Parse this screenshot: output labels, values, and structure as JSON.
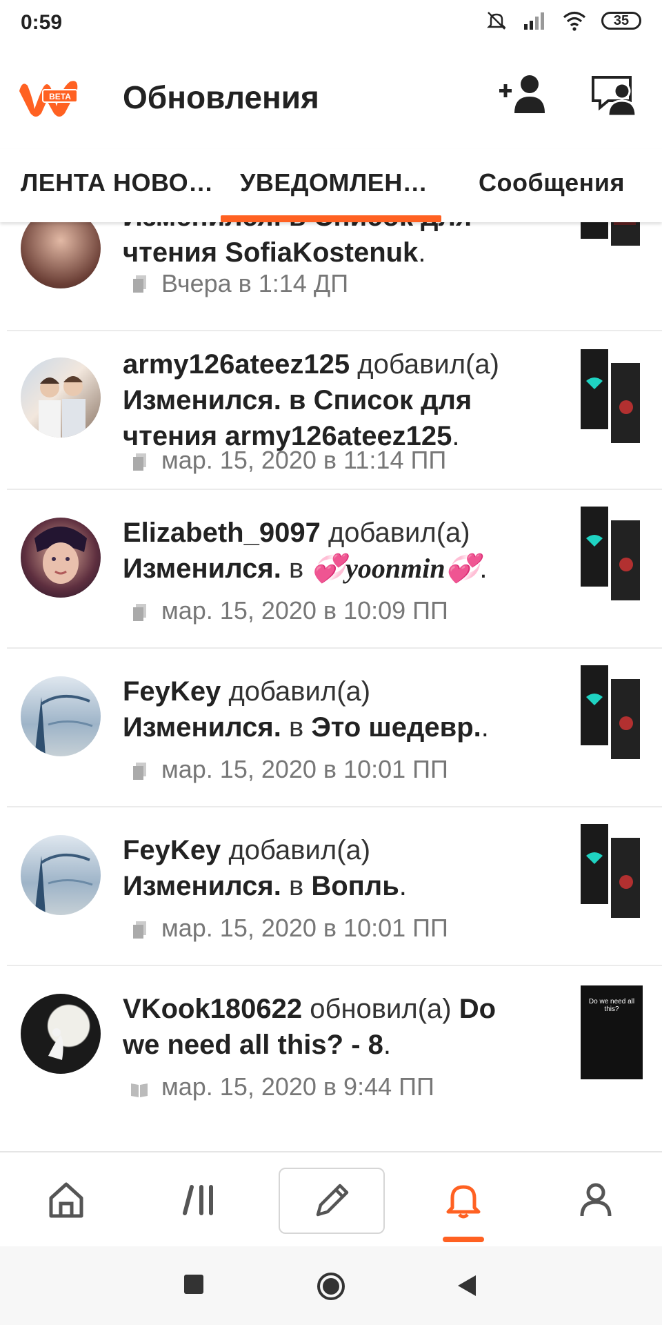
{
  "status_bar": {
    "time": "0:59",
    "battery": "35"
  },
  "app_bar": {
    "title": "Обновления",
    "logo_badge": "BETA"
  },
  "tabs": [
    {
      "label": "ЛЕНТА НОВО…"
    },
    {
      "label": "УВЕДОМЛЕН…"
    },
    {
      "label": "Сообщения"
    }
  ],
  "feed": [
    {
      "line_top": "Изменился. в Список для",
      "line2": "чтения SofiaKostenuk",
      "time": "Вчера в 1:14 ДП"
    },
    {
      "user": "army126ateez125",
      "verb": "добавил(а)",
      "line2": "Изменился. в Список для",
      "line3": "чтения army126ateez125",
      "time": "мар. 15, 2020 в 11:14 ПП"
    },
    {
      "user": "Elizabeth_9097",
      "verb": "добавил(а)",
      "story": "Изменился.",
      "in": "в",
      "list": "💞yoonmin💞",
      "time": "мар. 15, 2020 в 10:09 ПП"
    },
    {
      "user": "FeyKey",
      "verb": "добавил(а)",
      "story": "Изменился.",
      "in": "в",
      "list": "Это шедевр.",
      "time": "мар. 15, 2020 в 10:01 ПП"
    },
    {
      "user": "FeyKey",
      "verb": "добавил(а)",
      "story": "Изменился.",
      "in": "в",
      "list": "Вопль",
      "time": "мар. 15, 2020 в 10:01 ПП"
    },
    {
      "user": "VKook180622",
      "verb": "обновил(а)",
      "title_a": "Do",
      "title_b": "we need all this? - 8",
      "time": "мар. 15, 2020 в 9:44 ПП",
      "thumb_caption": "Do we need all this?"
    }
  ],
  "colors": {
    "accent": "#ff6122"
  }
}
